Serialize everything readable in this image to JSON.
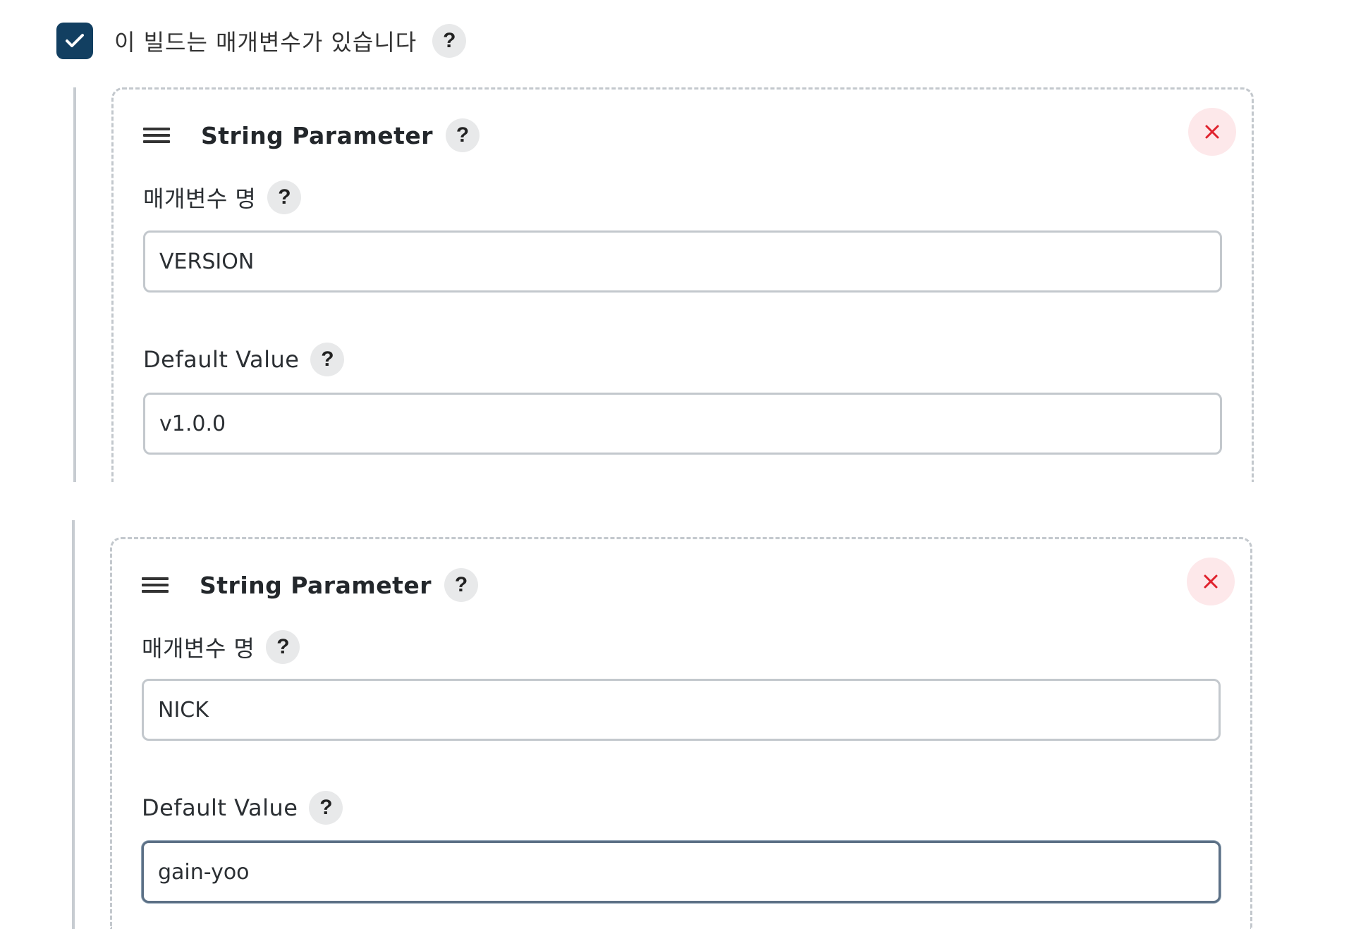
{
  "has_parameters": {
    "label": "이 빌드는 매개변수가 있습니다",
    "checked": true,
    "help_glyph": "?"
  },
  "colors": {
    "checkbox_bg": "#123f61",
    "close_bg": "#fde8ea",
    "close_x": "#e0222d",
    "help_bg": "#e8e9ea",
    "dash_border": "#c3c8cd"
  },
  "parameters": [
    {
      "type_label": "String Parameter",
      "help_glyph": "?",
      "name_label": "매개변수 명",
      "name_value": "VERSION",
      "default_label": "Default Value",
      "default_value": "v1.0.0"
    },
    {
      "type_label": "String Parameter",
      "help_glyph": "?",
      "name_label": "매개변수 명",
      "name_value": "NICK",
      "default_label": "Default Value",
      "default_value": "gain-yoo"
    }
  ]
}
